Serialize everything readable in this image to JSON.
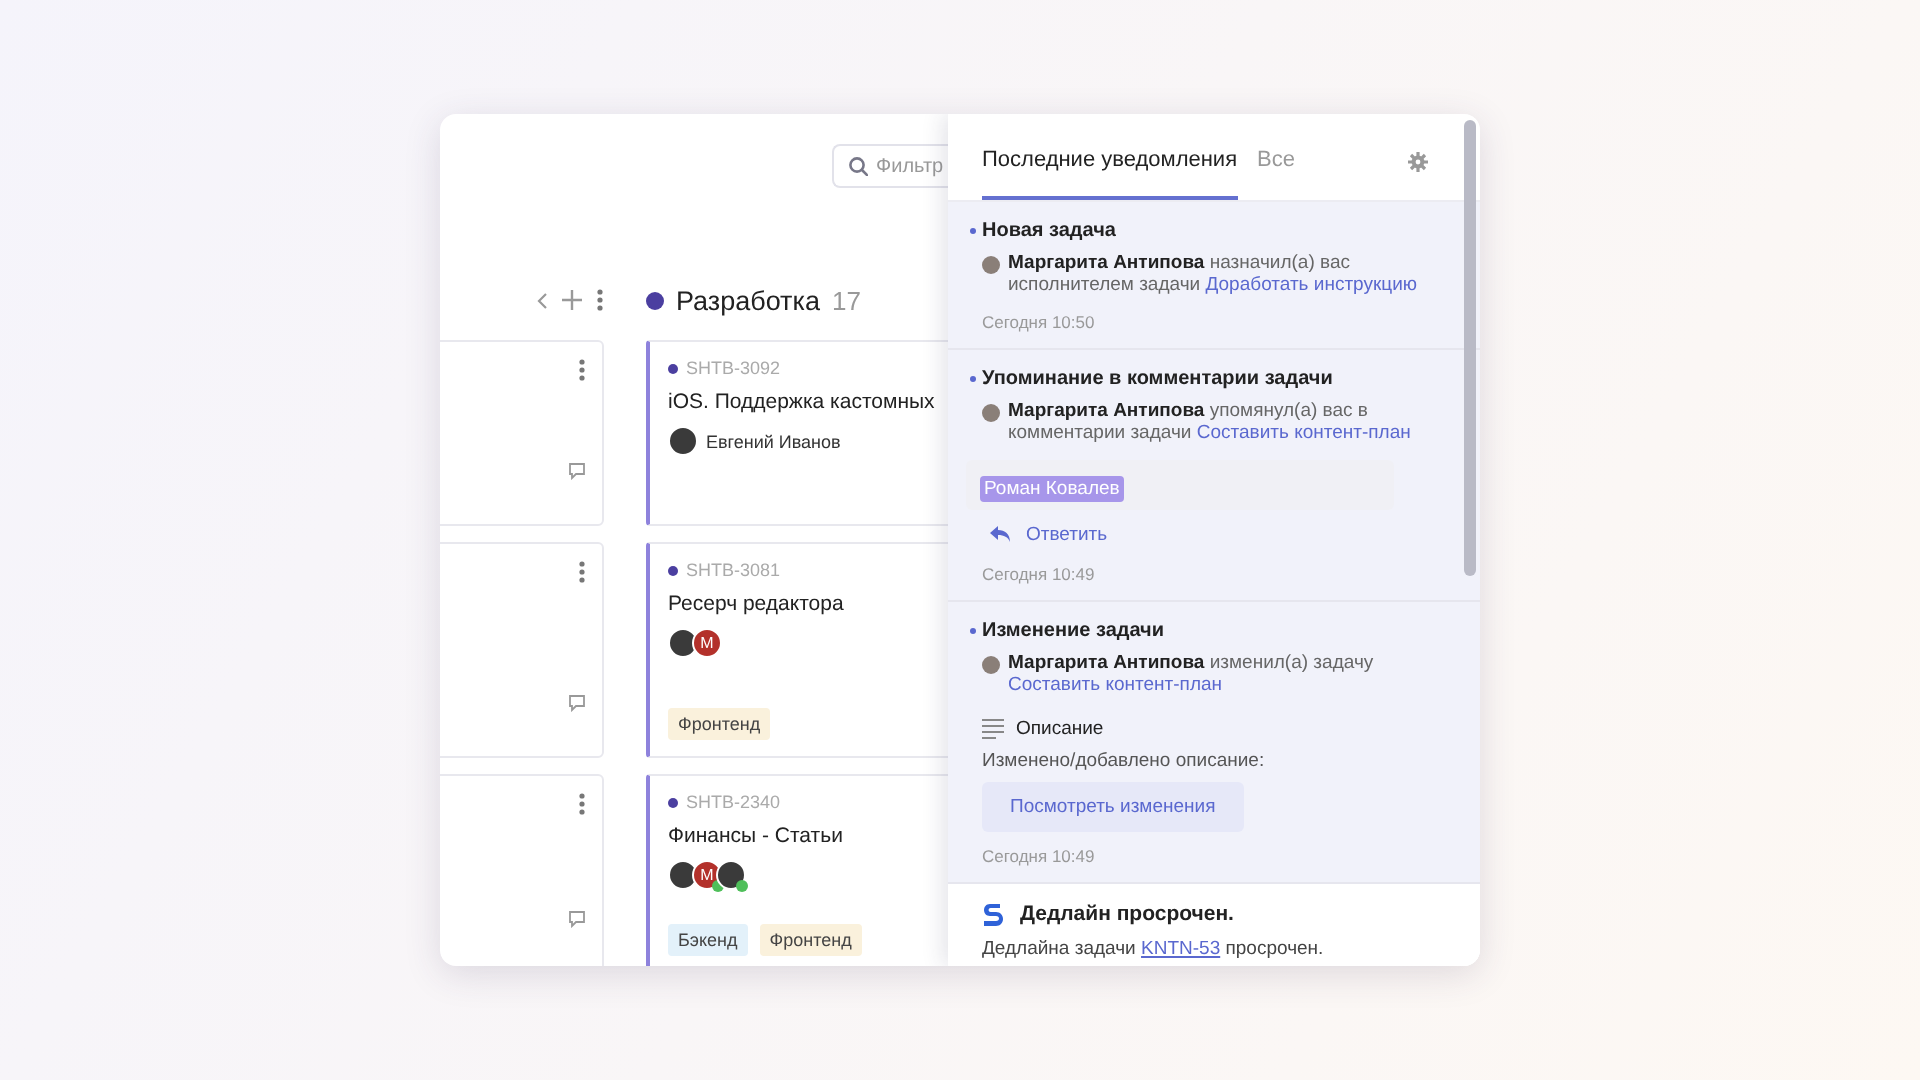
{
  "board": {
    "filter": {
      "placeholder": "Фильтр"
    },
    "left_column": {
      "cards": [
        {
          "comments": true
        },
        {
          "comments": true
        },
        {
          "comments": true
        }
      ]
    },
    "column": {
      "title": "Разработка",
      "count": "17",
      "color": "#4b3fa0",
      "cards": [
        {
          "id": "SHTB-3092",
          "title": "iOS. Поддержка кастомных",
          "assignee": "Евгений Иванов",
          "avatars": [
            {
              "kind": "photo",
              "approved": false
            }
          ]
        },
        {
          "id": "SHTB-3081",
          "title": "Ресерч редактора",
          "avatars": [
            {
              "kind": "photo",
              "approved": false
            },
            {
              "kind": "letter",
              "letter": "M",
              "approved": false
            }
          ],
          "tags": [
            {
              "label": "Фронтенд",
              "color": "#faf1dc"
            }
          ]
        },
        {
          "id": "SHTB-2340",
          "title": "Финансы - Статьи",
          "avatars": [
            {
              "kind": "photo",
              "approved": false
            },
            {
              "kind": "letter",
              "letter": "M",
              "approved": true
            },
            {
              "kind": "photo",
              "approved": true
            }
          ],
          "tags": [
            {
              "label": "Бэкенд",
              "color": "#e3f1fa"
            },
            {
              "label": "Фронтенд",
              "color": "#faf1dc"
            }
          ]
        }
      ]
    }
  },
  "notifications_panel": {
    "tabs": [
      {
        "label": "Последние уведомления",
        "selected": true
      },
      {
        "label": "Все",
        "selected": false
      }
    ],
    "items": [
      {
        "kind": "event",
        "unread": true,
        "title": "Новая задача",
        "author": "Маргарита Антипова",
        "action": "назначил(а) вас исполнителем задачи",
        "link": "Доработать инструкцию",
        "time": "Сегодня 10:50"
      },
      {
        "kind": "event",
        "unread": true,
        "title": "Упоминание в комментарии задачи",
        "author": "Маргарита Антипова",
        "action": "упомянул(а) вас в комментарии задачи",
        "link": "Составить контент-план",
        "mention": "Роман Ковалев",
        "reply": "Ответить",
        "time": "Сегодня 10:49"
      },
      {
        "kind": "event",
        "unread": true,
        "title": "Изменение задачи",
        "author": "Маргарита Антипова",
        "action": "изменил(а) задачу",
        "link": "Составить контент-план",
        "change": {
          "field": "Описание",
          "text": "Изменено/добавлено описание:",
          "button": "Посмотреть изменения"
        },
        "time": "Сегодня 10:49"
      },
      {
        "kind": "system",
        "unread": false,
        "title": "Дедлайн просрочен.",
        "text_before": "Дедлайна задачи",
        "link": "KNTN-53",
        "text_after": "просрочен."
      }
    ]
  }
}
